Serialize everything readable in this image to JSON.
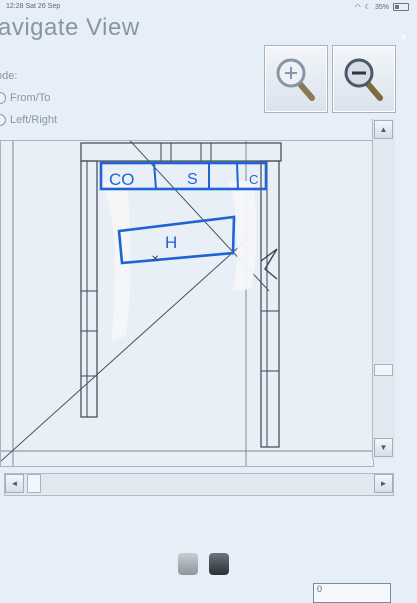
{
  "status": {
    "time": "12:28",
    "date": "Sat 26 Sep",
    "battery": "35%"
  },
  "window": {
    "title": "avigate View",
    "close": "×"
  },
  "mode": {
    "label": "ode:",
    "options": [
      {
        "label": "From/To",
        "selected": false
      },
      {
        "label": "Left/Right",
        "selected": false
      }
    ]
  },
  "zoom": {
    "in_icon": "zoom-in-icon",
    "out_icon": "zoom-out-icon"
  },
  "annotations": {
    "labels": [
      "CO",
      "S",
      "C"
    ],
    "box_label": "H"
  },
  "scrollbars": {
    "up": "▲",
    "down": "▼",
    "left": "◄",
    "right": "►"
  },
  "bottom_field": {
    "value": "0"
  },
  "colors": {
    "marker": "#1f63d6",
    "background": "#e6eef7",
    "line": "#3d4550"
  }
}
